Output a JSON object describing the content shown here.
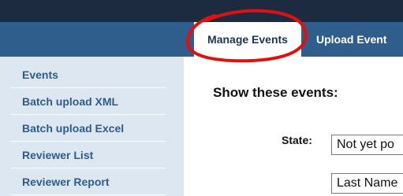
{
  "nav": {
    "tabs": [
      {
        "label": "Manage Events",
        "active": true
      },
      {
        "label": "Upload Event",
        "active": false
      }
    ]
  },
  "sidebar": {
    "items": [
      {
        "label": "Events"
      },
      {
        "label": "Batch upload XML"
      },
      {
        "label": "Batch upload Excel"
      },
      {
        "label": "Reviewer List"
      },
      {
        "label": "Reviewer Report"
      }
    ]
  },
  "main": {
    "heading": "Show these events:",
    "state_label": "State:",
    "state_value": "Not yet po",
    "sort_value": "Last Name"
  },
  "colors": {
    "topbar": "#1c2b3f",
    "navbar": "#2f5d8c",
    "sidebar": "#dde7f1",
    "link": "#2c5d8f",
    "annotation": "#e01010"
  },
  "annotation": {
    "shape": "hand-drawn ellipse",
    "target": "Manage Events tab"
  }
}
